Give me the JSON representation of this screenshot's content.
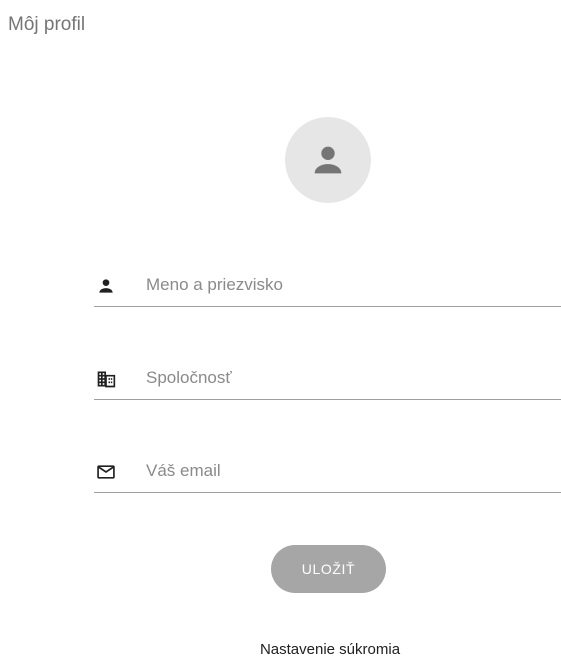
{
  "header": {
    "title": "Môj profil"
  },
  "profile": {
    "avatar_icon": "person-icon"
  },
  "form": {
    "name": {
      "icon": "person-icon",
      "placeholder": "Meno a priezvisko",
      "value": ""
    },
    "company": {
      "icon": "building-icon",
      "placeholder": "Spoločnosť",
      "value": ""
    },
    "email": {
      "icon": "mail-icon",
      "placeholder": "Váš email",
      "value": ""
    },
    "save_label": "ULOŽIŤ"
  },
  "footer": {
    "privacy_link": "Nastavenie súkromia"
  },
  "colors": {
    "avatar_bg": "#e6e6e6",
    "avatar_icon": "#757575",
    "button_bg": "#a6a6a6",
    "button_text": "#ffffff",
    "underline": "#9e9e9e"
  }
}
